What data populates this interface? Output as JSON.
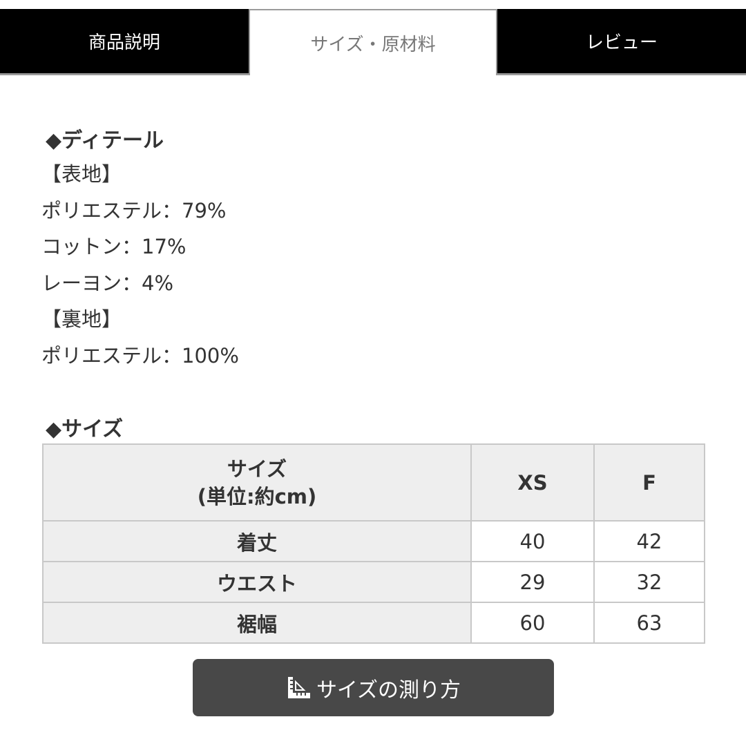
{
  "tabs": [
    {
      "label": "商品説明",
      "active": false
    },
    {
      "label": "サイズ・原材料",
      "active": true
    },
    {
      "label": "レビュー",
      "active": false
    }
  ],
  "detail": {
    "heading": "◆ディテール",
    "lines": [
      "【表地】",
      "ポリエステル：79%",
      "コットン：17%",
      "レーヨン：4%",
      "【裏地】",
      "ポリエステル：100%"
    ]
  },
  "size": {
    "heading": "◆サイズ",
    "table": {
      "header_line1": "サイズ",
      "header_line2": "(単位:約cm)",
      "columns": [
        "XS",
        "F"
      ],
      "rows": [
        {
          "label": "着丈",
          "values": [
            "40",
            "42"
          ]
        },
        {
          "label": "ウエスト",
          "values": [
            "29",
            "32"
          ]
        },
        {
          "label": "裾幅",
          "values": [
            "60",
            "63"
          ]
        }
      ]
    }
  },
  "measure_button": {
    "label": "サイズの測り方",
    "icon": "ruler-measure-icon"
  },
  "colors": {
    "tab_dark": "#000000",
    "table_header_bg": "#eeeeee",
    "table_border": "#c8c8c8",
    "button_bg": "#484848"
  }
}
